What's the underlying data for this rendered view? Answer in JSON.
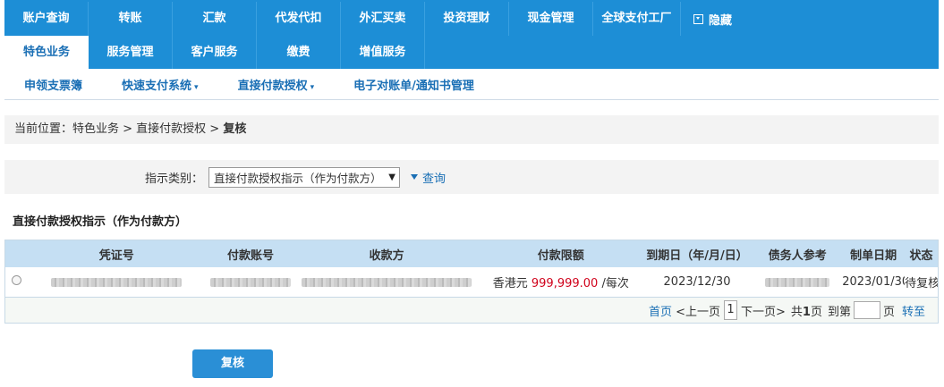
{
  "nav": {
    "row1": [
      "账户查询",
      "转账",
      "汇款",
      "代发代扣",
      "外汇买卖",
      "投资理财",
      "现金管理",
      "全球支付工厂"
    ],
    "hide_label": "隐藏",
    "row2": [
      "特色业务",
      "服务管理",
      "客户服务",
      "缴费",
      "增值服务"
    ]
  },
  "subnav": {
    "items": [
      "申领支票簿",
      "快速支付系统",
      "直接付款授权",
      "电子对账单/通知书管理"
    ]
  },
  "breadcrumb": {
    "prefix": "当前位置：特色业务 > 直接付款授权 > ",
    "current": "复核"
  },
  "filter": {
    "label": "指示类别：",
    "selected": "直接付款授权指示（作为付款方）",
    "query_label": "查询"
  },
  "section_title": "直接付款授权指示（作为付款方）",
  "table": {
    "headers": [
      "凭证号",
      "付款账号",
      "收款方",
      "付款限额",
      "到期日（年/月/日）",
      "债务人参考",
      "制单日期",
      "状态"
    ],
    "rows": [
      {
        "currency": "香港元",
        "amount": "999,999.00",
        "per": "/每次",
        "due_date": "2023/12/30",
        "created": "2023/01/30",
        "status": "待复核"
      }
    ]
  },
  "pager": {
    "first": "首页",
    "prev": "<上一页",
    "page": "1",
    "next": "下一页>",
    "total_prefix": "共",
    "total_pages": "1",
    "total_suffix": "页",
    "goto_prefix": "到第",
    "goto_suffix": "页",
    "goto_btn": "转至"
  },
  "submit_label": "复核"
}
